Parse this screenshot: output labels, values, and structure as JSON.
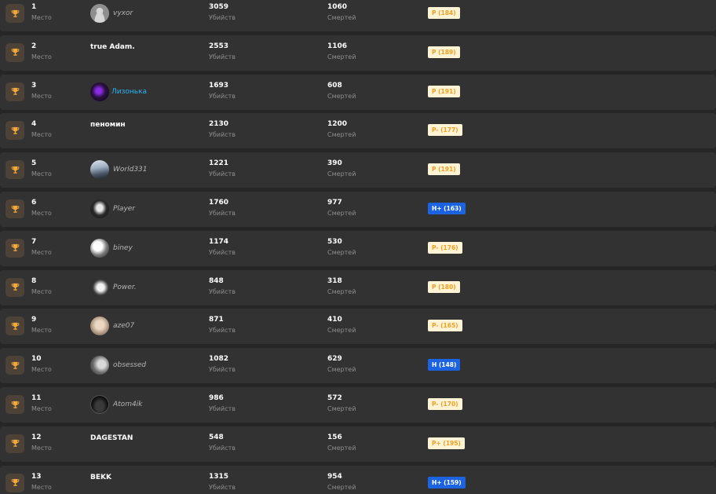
{
  "labels": {
    "place": "Место",
    "kills": "Убийств",
    "deaths": "Смертей"
  },
  "colors": {
    "rank_p": "#f0a020",
    "rank_h": "#1b63e0",
    "highlight_name": "#29b6f6"
  },
  "rows": [
    {
      "place": "1",
      "name": "vyxor",
      "kills": "3059",
      "deaths": "1060",
      "rank": "P (184)",
      "rank_type": "p",
      "avatar": "default-user",
      "style": "avatar"
    },
    {
      "place": "2",
      "name": "true Adam.",
      "kills": "2553",
      "deaths": "1106",
      "rank": "P (189)",
      "rank_type": "p",
      "avatar": "",
      "style": "plain"
    },
    {
      "place": "3",
      "name": "Лизонька",
      "kills": "1693",
      "deaths": "608",
      "rank": "P (191)",
      "rank_type": "p",
      "avatar": "purple-glow",
      "style": "special"
    },
    {
      "place": "4",
      "name": "пеномин",
      "kills": "2130",
      "deaths": "1200",
      "rank": "P- (177)",
      "rank_type": "p",
      "avatar": "",
      "style": "plain"
    },
    {
      "place": "5",
      "name": "World331",
      "kills": "1221",
      "deaths": "390",
      "rank": "P (191)",
      "rank_type": "p",
      "avatar": "landscape",
      "style": "avatar"
    },
    {
      "place": "6",
      "name": "Player",
      "kills": "1760",
      "deaths": "977",
      "rank": "H+ (163)",
      "rank_type": "h",
      "avatar": "dark-portrait",
      "style": "avatar"
    },
    {
      "place": "7",
      "name": "biney",
      "kills": "1174",
      "deaths": "530",
      "rank": "P- (176)",
      "rank_type": "p",
      "avatar": "bw-figure",
      "style": "avatar"
    },
    {
      "place": "8",
      "name": "Power.",
      "kills": "848",
      "deaths": "318",
      "rank": "P (180)",
      "rank_type": "p",
      "avatar": "bw-face",
      "style": "avatar"
    },
    {
      "place": "9",
      "name": "aze07",
      "kills": "871",
      "deaths": "410",
      "rank": "P- (165)",
      "rank_type": "p",
      "avatar": "beige-face",
      "style": "avatar"
    },
    {
      "place": "10",
      "name": "obsessed",
      "kills": "1082",
      "deaths": "629",
      "rank": "H (148)",
      "rank_type": "h",
      "avatar": "grey-figure",
      "style": "avatar"
    },
    {
      "place": "11",
      "name": "Atom4ik",
      "kills": "986",
      "deaths": "572",
      "rank": "P- (170)",
      "rank_type": "p",
      "avatar": "helmet",
      "style": "avatar"
    },
    {
      "place": "12",
      "name": "DAGESTAN",
      "kills": "548",
      "deaths": "156",
      "rank": "P+ (195)",
      "rank_type": "p",
      "avatar": "",
      "style": "plain"
    },
    {
      "place": "13",
      "name": "BEKK",
      "kills": "1315",
      "deaths": "954",
      "rank": "H+ (159)",
      "rank_type": "h",
      "avatar": "",
      "style": "plain"
    }
  ]
}
